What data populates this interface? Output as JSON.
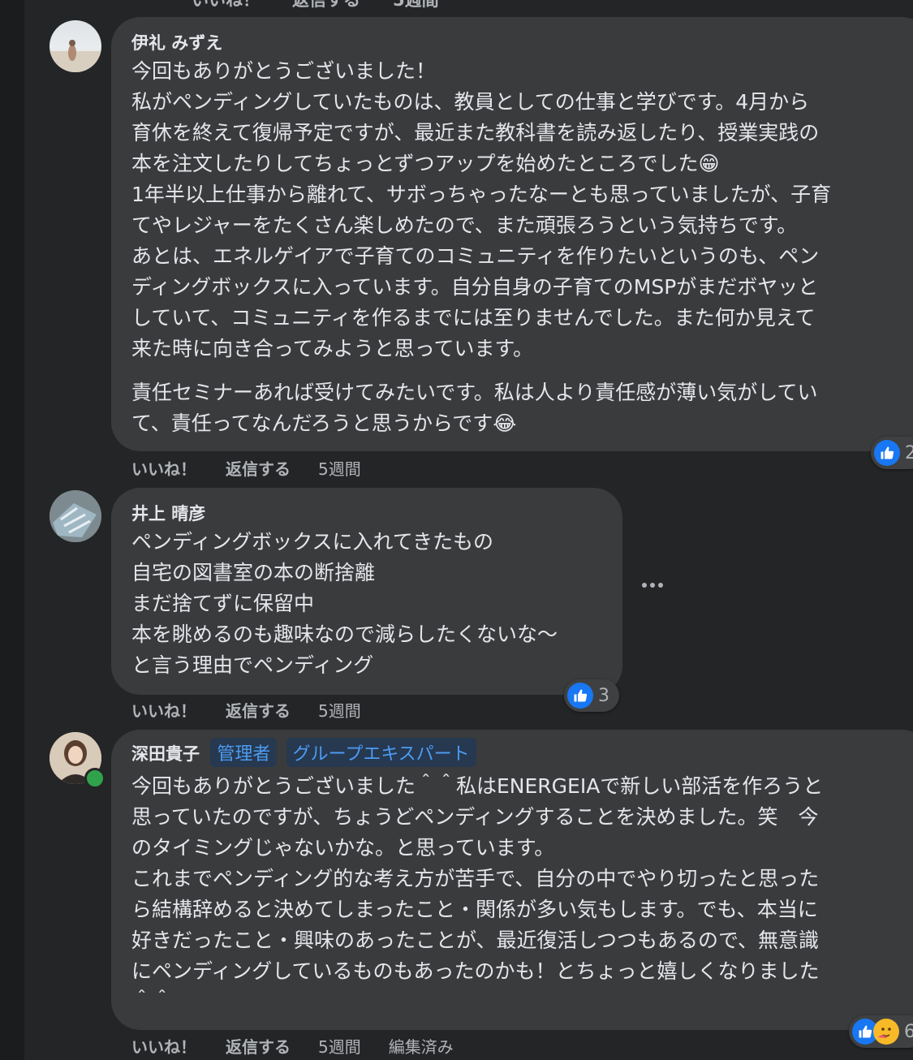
{
  "top_cut": {
    "like": "いいね！",
    "reply": "返信する",
    "time": "5週間"
  },
  "comments": [
    {
      "name": "伊礼 みずえ",
      "paragraph1": "今回もありがとうございました！\n私がペンディングしていたものは、教員としての仕事と学びです。4月から\n育休を終えて復帰予定ですが、最近また教科書を読み返したり、授業実践の\n本を注文したりしてちょっとずつアップを始めたところでした😁\n1年半以上仕事から離れて、サボっちゃったなーとも思っていましたが、子育\nてやレジャーをたくさん楽しめたので、また頑張ろうという気持ちです。\nあとは、エネルゲイアで子育てのコミュニティを作りたいというのも、ペン\nディングボックスに入っています。自分自身の子育てのMSPがまだボヤッと\nしていて、コミュニティを作るまでには至りませんでした。また何か見えて\n来た時に向き合ってみようと思っています。",
      "paragraph2": "責任セミナーあれば受けてみたいです。私は人より責任感が薄い気がしてい\nて、責任ってなんだろうと思うからです😂",
      "like": "いいね！",
      "reply": "返信する",
      "time": "5週間",
      "reaction_count": "2"
    },
    {
      "name": "井上 晴彦",
      "text": "ペンディングボックスに入れてきたもの\n自宅の図書室の本の断捨離\nまだ捨てずに保留中\n本を眺めるのも趣味なので減らしたくないな〜\nと言う理由でペンディング",
      "like": "いいね！",
      "reply": "返信する",
      "time": "5週間",
      "reaction_count": "3"
    },
    {
      "name": "深田貴子",
      "badges": [
        "管理者",
        "グループエキスパート"
      ],
      "text": "今回もありがとうございました＾＾私はENERGEIAで新しい部活を作ろうと\n思っていたのですが、ちょうどペンディングすることを決めました。笑　今\nのタイミングじゃないかな。と思っています。\nこれまでペンディング的な考え方が苦手で、自分の中でやり切ったと思った\nら結構辞めると決めてしまったこと・関係が多い気もします。でも、本当に\n好きだったこと・興味のあったことが、最近復活しつつもあるので、無意識\nにペンディングしているものもあったのかも！とちょっと嬉しくなりました\n＾＾",
      "like": "いいね！",
      "reply": "返信する",
      "time": "5週間",
      "edited": "編集済み",
      "reaction_count": "6"
    }
  ],
  "icons": {
    "reactions": [
      "like-icon",
      "haha-icon"
    ],
    "menu": "more-options-icon"
  },
  "colors": {
    "background": "#242526",
    "bubble": "#3a3b3c",
    "like_blue": "#1877f2",
    "badge_text": "#4d9bf0",
    "online": "#31a24c"
  }
}
